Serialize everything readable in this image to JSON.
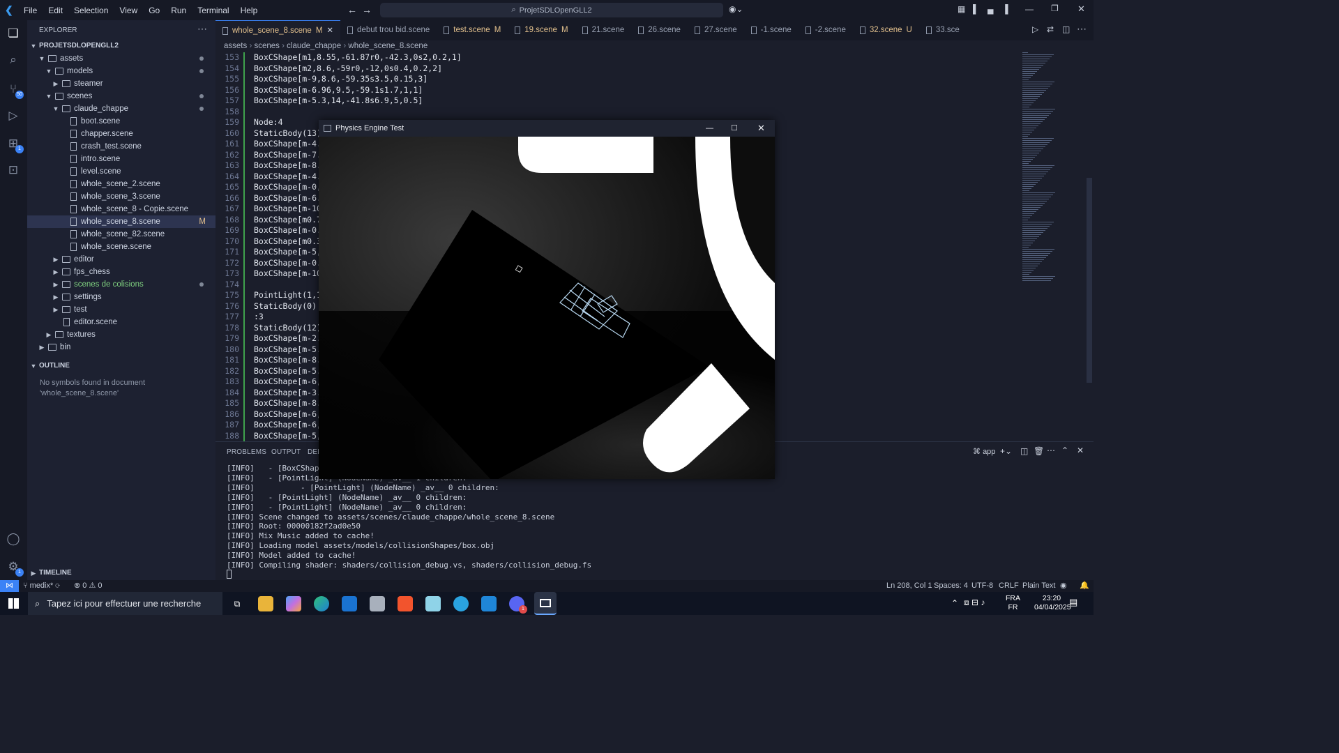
{
  "menu": [
    "File",
    "Edit",
    "Selection",
    "View",
    "Go",
    "Run",
    "Terminal",
    "Help"
  ],
  "command_center": "ProjetSDLOpenGLL2",
  "explorer": {
    "title": "EXPLORER",
    "project": "PROJETSDLOPENGLL2",
    "tree": [
      {
        "label": "assets",
        "depth": 1,
        "folder": true,
        "open": true,
        "dot": true
      },
      {
        "label": "models",
        "depth": 2,
        "folder": true,
        "open": true,
        "dot": true
      },
      {
        "label": "steamer",
        "depth": 3,
        "folder": true,
        "open": false
      },
      {
        "label": "scenes",
        "depth": 2,
        "folder": true,
        "open": true,
        "dot": true
      },
      {
        "label": "claude_chappe",
        "depth": 3,
        "folder": true,
        "open": true,
        "dot": true
      },
      {
        "label": "boot.scene",
        "depth": 4
      },
      {
        "label": "chapper.scene",
        "depth": 4
      },
      {
        "label": "crash_test.scene",
        "depth": 4
      },
      {
        "label": "intro.scene",
        "depth": 4
      },
      {
        "label": "level.scene",
        "depth": 4
      },
      {
        "label": "whole_scene_2.scene",
        "depth": 4
      },
      {
        "label": "whole_scene_3.scene",
        "depth": 4
      },
      {
        "label": "whole_scene_8 - Copie.scene",
        "depth": 4
      },
      {
        "label": "whole_scene_8.scene",
        "depth": 4,
        "selected": true,
        "mark": "M"
      },
      {
        "label": "whole_scene_82.scene",
        "depth": 4
      },
      {
        "label": "whole_scene.scene",
        "depth": 4
      },
      {
        "label": "editor",
        "depth": 3,
        "folder": true,
        "open": false
      },
      {
        "label": "fps_chess",
        "depth": 3,
        "folder": true,
        "open": false
      },
      {
        "label": "scenes de colisions",
        "depth": 3,
        "folder": true,
        "open": false,
        "dot": true,
        "color": "#7fd07f"
      },
      {
        "label": "settings",
        "depth": 3,
        "folder": true,
        "open": false
      },
      {
        "label": "test",
        "depth": 3,
        "folder": true,
        "open": false
      },
      {
        "label": "editor.scene",
        "depth": 3
      },
      {
        "label": "textures",
        "depth": 2,
        "folder": true,
        "open": false
      },
      {
        "label": "bin",
        "depth": 1,
        "folder": true,
        "open": false
      }
    ],
    "outline_title": "OUTLINE",
    "outline_msg1": "No symbols found in document",
    "outline_msg2": "'whole_scene_8.scene'",
    "timeline_title": "TIMELINE"
  },
  "tabs": [
    {
      "label": "whole_scene_8.scene",
      "mark": "M",
      "active": true
    },
    {
      "label": "debut trou bid.scene"
    },
    {
      "label": "test.scene",
      "mark": "M"
    },
    {
      "label": "19.scene",
      "mark": "M"
    },
    {
      "label": "21.scene"
    },
    {
      "label": "26.scene"
    },
    {
      "label": "27.scene"
    },
    {
      "label": "-1.scene"
    },
    {
      "label": "-2.scene"
    },
    {
      "label": "32.scene",
      "mark": "U"
    },
    {
      "label": "33.sce"
    }
  ],
  "breadcrumb": [
    "assets",
    "scenes",
    "claude_chappe",
    "whole_scene_8.scene"
  ],
  "code_lines": [
    {
      "n": "153",
      "t": "BoxCShape[m1,8.55,-61.87r0,-42.3,0s2,0.2,1]"
    },
    {
      "n": "154",
      "t": "BoxCShape[m2,8.6,-59r0,-12,0s0.4,0.2,2]"
    },
    {
      "n": "155",
      "t": "BoxCShape[m-9,8.6,-59.35s3.5,0.15,3]"
    },
    {
      "n": "156",
      "t": "BoxCShape[m-6.96,9.5,-59.1s1.7,1,1]"
    },
    {
      "n": "157",
      "t": "BoxCShape[m-5.3,14,-41.8s6.9,5,0.5]"
    },
    {
      "n": "158",
      "t": ""
    },
    {
      "n": "159",
      "t": "Node:4"
    },
    {
      "n": "160",
      "t": "StaticBody(13)"
    },
    {
      "n": "161",
      "t": "BoxCShape[m-4.4"
    },
    {
      "n": "162",
      "t": "BoxCShape[m-7.7"
    },
    {
      "n": "163",
      "t": "BoxCShape[m-8.5"
    },
    {
      "n": "164",
      "t": "BoxCShape[m-4.5"
    },
    {
      "n": "165",
      "t": "BoxCShape[m-0,0"
    },
    {
      "n": "166",
      "t": "BoxCShape[m-6.9"
    },
    {
      "n": "167",
      "t": "BoxCShape[m-10."
    },
    {
      "n": "168",
      "t": "BoxCShape[m0.7,"
    },
    {
      "n": "169",
      "t": "BoxCShape[m-0.9"
    },
    {
      "n": "170",
      "t": "BoxCShape[m0.3,"
    },
    {
      "n": "171",
      "t": "BoxCShape[m-5,-"
    },
    {
      "n": "172",
      "t": "BoxCShape[m-0.8"
    },
    {
      "n": "173",
      "t": "BoxCShape[m-10."
    },
    {
      "n": "174",
      "t": ""
    },
    {
      "n": "175",
      "t": "PointLight(1,1,"
    },
    {
      "n": "176",
      "t": "StaticBody(0)"
    },
    {
      "n": "177",
      "t": ":3"
    },
    {
      "n": "178",
      "t": "StaticBody(12)"
    },
    {
      "n": "179",
      "t": "BoxCShape[m-2.6"
    },
    {
      "n": "180",
      "t": "BoxCShape[m-5.5"
    },
    {
      "n": "181",
      "t": "BoxCShape[m-8.5"
    },
    {
      "n": "182",
      "t": "BoxCShape[m-5.8"
    },
    {
      "n": "183",
      "t": "BoxCShape[m-6,-"
    },
    {
      "n": "184",
      "t": "BoxCShape[m-3.1"
    },
    {
      "n": "185",
      "t": "BoxCShape[m-8.5"
    },
    {
      "n": "186",
      "t": "BoxCShape[m-6,-"
    },
    {
      "n": "187",
      "t": "BoxCShape[m-6,-"
    },
    {
      "n": "188",
      "t": "BoxCShape[m-5,-"
    }
  ],
  "panel": {
    "tabs": [
      "PROBLEMS",
      "OUTPUT",
      "DEB"
    ],
    "terminal_name": "app",
    "lines": [
      "[INFO]   - [BoxCShape]",
      "[INFO]   - [PointLight] (NodeName) _av__ 1 children:",
      "[INFO]          - [PointLight] (NodeName) _av__ 0 children:",
      "[INFO]   - [PointLight] (NodeName) _av__ 0 children:",
      "[INFO]   - [PointLight] (NodeName) _av__ 0 children:",
      "[INFO] Scene changed to assets/scenes/claude_chappe/whole_scene_8.scene",
      "[INFO] Root: 00000182f2ad0e50",
      "[INFO] Mix Music added to cache!",
      "[INFO] Loading model assets/models/collisionShapes/box.obj",
      "[INFO] Model added to cache!",
      "[INFO] Compiling shader: shaders/collision_debug.vs, shaders/collision_debug.fs"
    ]
  },
  "physics_window": {
    "title": "Physics Engine Test"
  },
  "status": {
    "branch": "medix*",
    "errors": "0",
    "warnings": "0",
    "position": "Ln 208, Col 1",
    "spaces": "Spaces: 4",
    "encoding": "UTF-8",
    "eol": "CRLF",
    "language": "Plain Text"
  },
  "taskbar": {
    "search_placeholder": "Tapez ici pour effectuer une recherche",
    "lang1": "FRA",
    "lang2": "FR",
    "time": "23:20",
    "date": "04/04/2025"
  },
  "badges": {
    "source_control": "50",
    "extensions": "1",
    "accounts_settings": "1",
    "discord": "1"
  }
}
